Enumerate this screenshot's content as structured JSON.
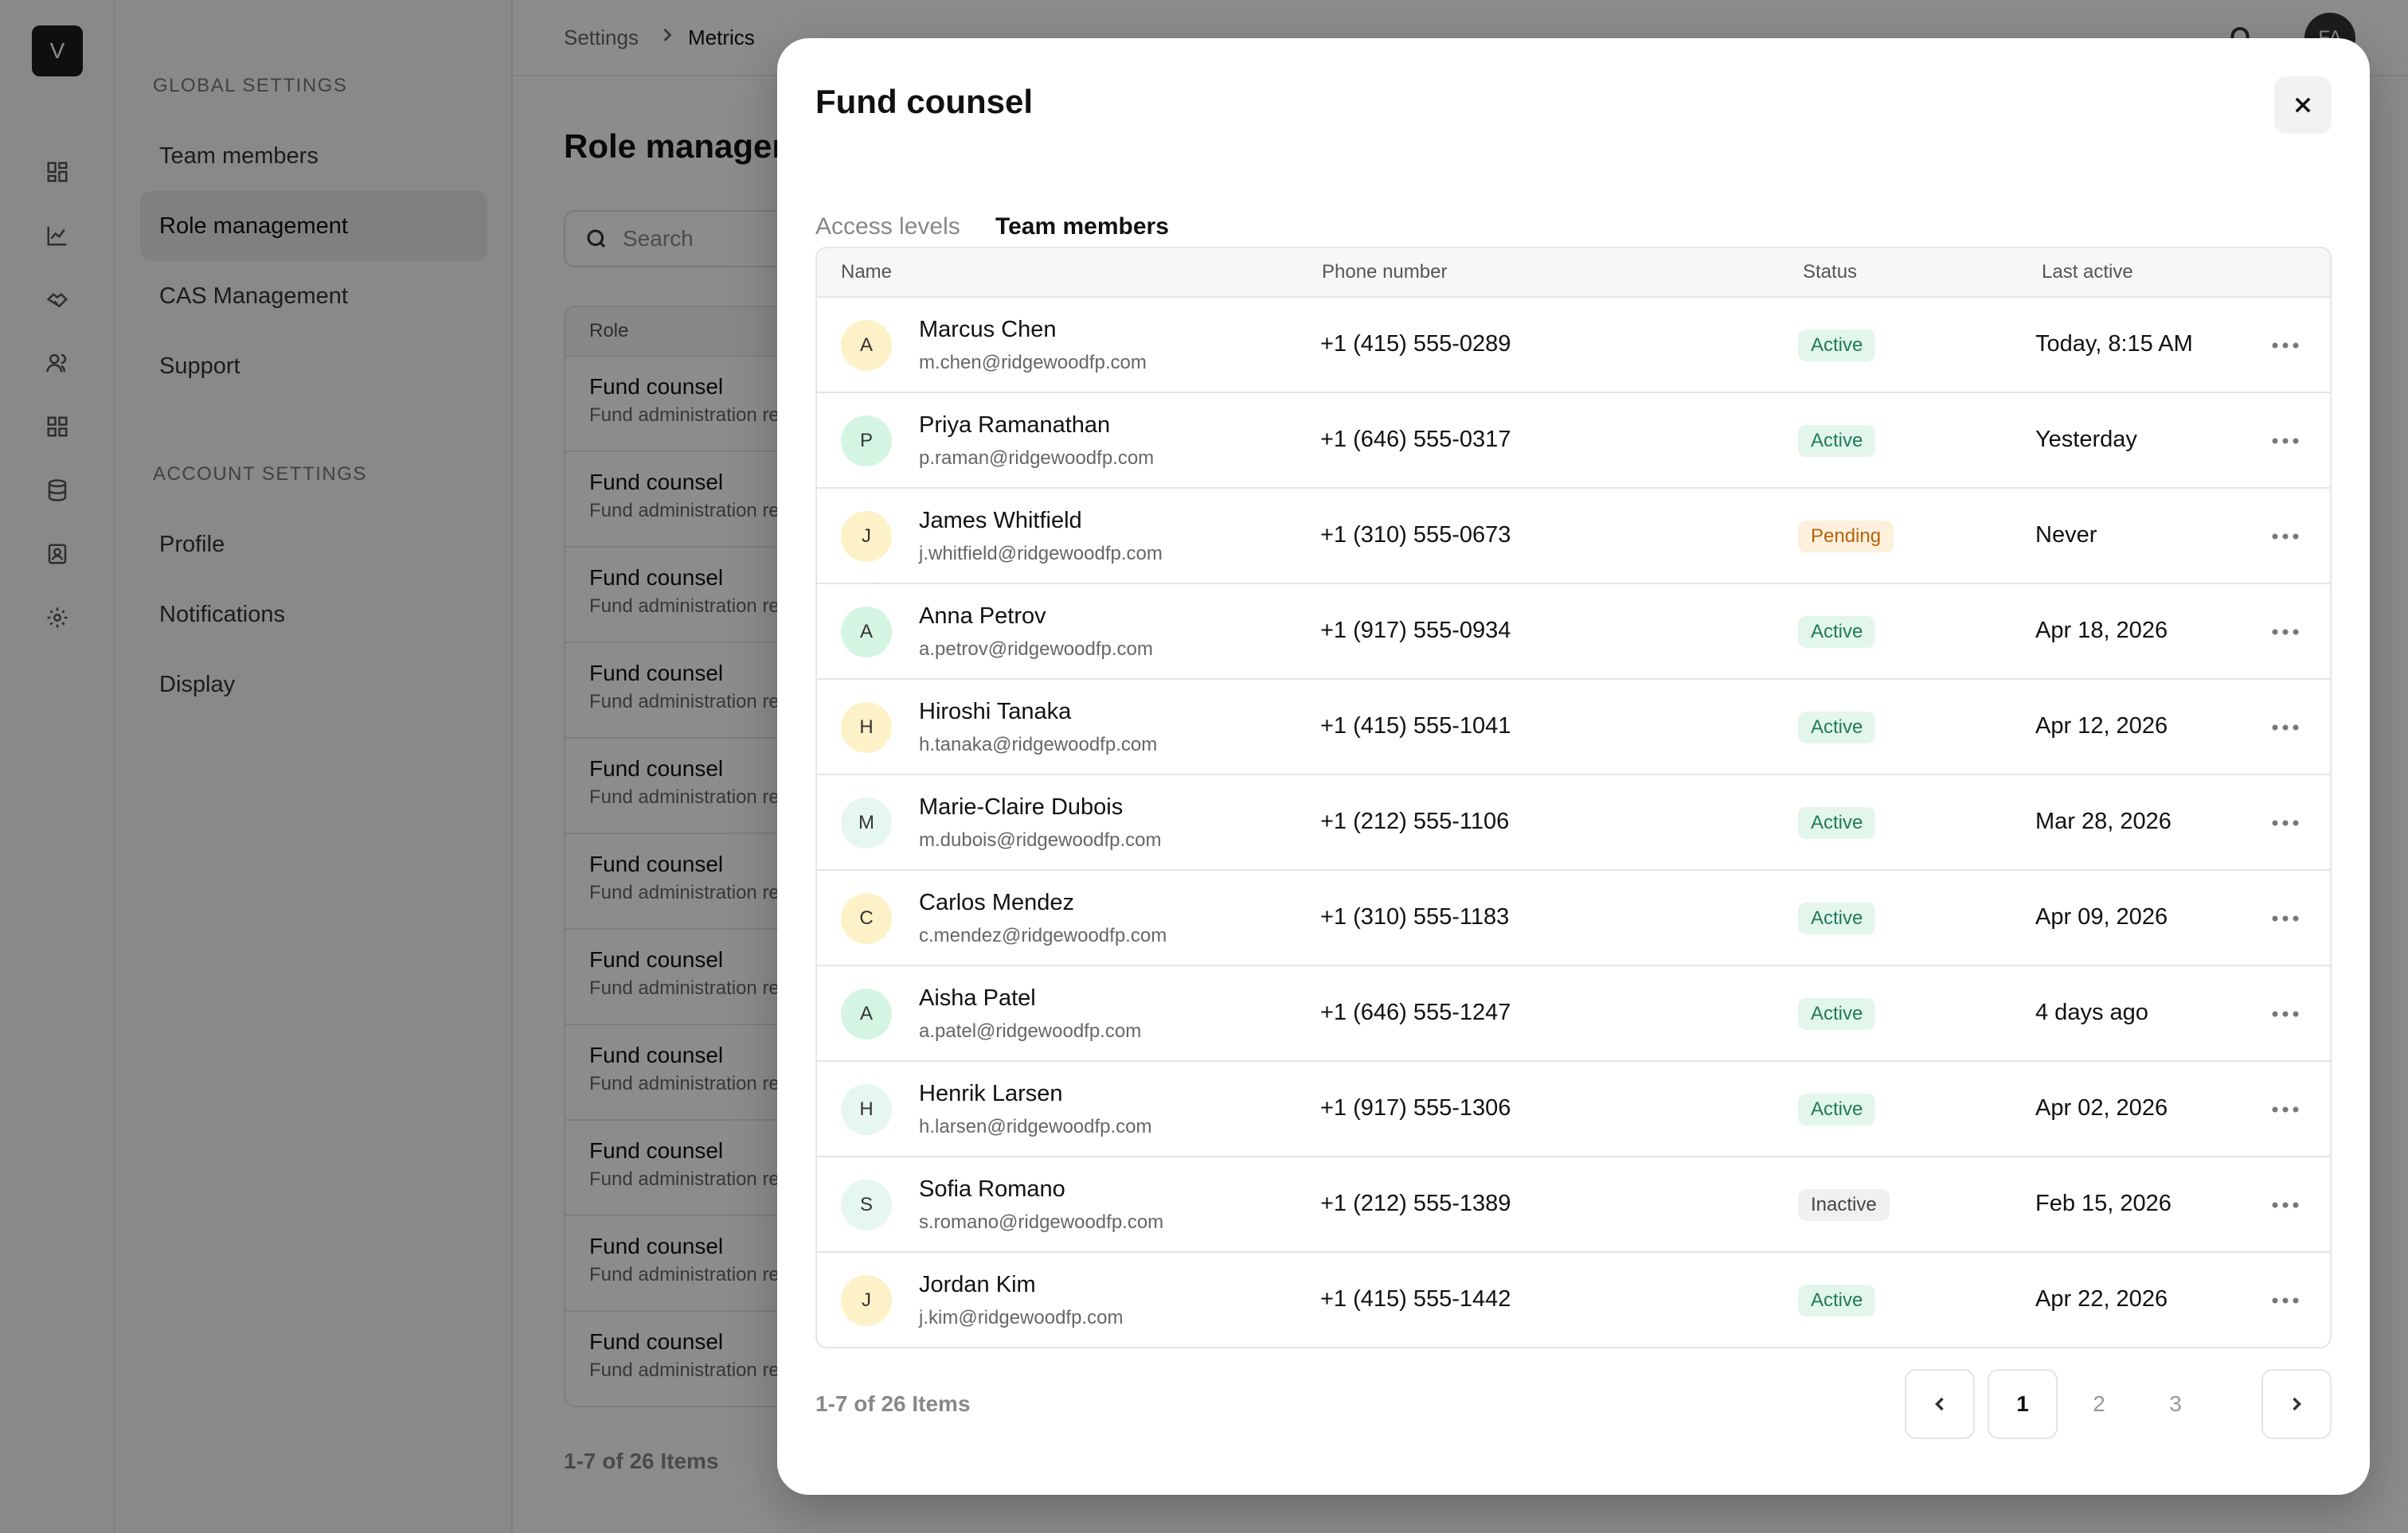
{
  "app": {
    "logo_letter": "V",
    "user_initials": "FA",
    "rail_icons": [
      "dashboard-icon",
      "chart-icon",
      "handshake-icon",
      "users-icon",
      "grid-icon",
      "database-icon",
      "contacts-icon",
      "gear-icon"
    ]
  },
  "settings_nav": {
    "global_heading": "GLOBAL SETTINGS",
    "global_items": [
      "Team members",
      "Role management",
      "CAS Management",
      "Support"
    ],
    "account_heading": "ACCOUNT SETTINGS",
    "account_items": [
      "Profile",
      "Notifications",
      "Display"
    ],
    "active_item": "Role management"
  },
  "background": {
    "breadcrumb": [
      "Settings",
      "Metrics"
    ],
    "page_title": "Role managen",
    "search_placeholder": "Search",
    "column_role": "Role",
    "role_rows": [
      {
        "title": "Fund counsel",
        "subtitle": "Fund administration re"
      },
      {
        "title": "Fund counsel",
        "subtitle": "Fund administration re"
      },
      {
        "title": "Fund counsel",
        "subtitle": "Fund administration re"
      },
      {
        "title": "Fund counsel",
        "subtitle": "Fund administration re"
      },
      {
        "title": "Fund counsel",
        "subtitle": "Fund administration re"
      },
      {
        "title": "Fund counsel",
        "subtitle": "Fund administration re"
      },
      {
        "title": "Fund counsel",
        "subtitle": "Fund administration re"
      },
      {
        "title": "Fund counsel",
        "subtitle": "Fund administration re"
      },
      {
        "title": "Fund counsel",
        "subtitle": "Fund administration re"
      },
      {
        "title": "Fund counsel",
        "subtitle": "Fund administration re"
      },
      {
        "title": "Fund counsel",
        "subtitle": "Fund administration re"
      }
    ],
    "footer_count": "1-7 of 26 Items"
  },
  "modal": {
    "title": "Fund counsel",
    "tabs": [
      "Access levels",
      "Team members"
    ],
    "active_tab": "Team members",
    "columns": [
      "Name",
      "Phone number",
      "Status",
      "Last active"
    ],
    "members": [
      {
        "initial": "A",
        "name": "Marcus Chen",
        "email": "m.chen@ridgewoodfp.com",
        "phone": "+1 (415) 555-0289",
        "status": "Active",
        "last_active": "Today, 8:15 AM",
        "avatar_color": "#fdf1c7"
      },
      {
        "initial": "P",
        "name": "Priya Ramanathan",
        "email": "p.raman@ridgewoodfp.com",
        "phone": "+1 (646) 555-0317",
        "status": "Active",
        "last_active": "Yesterday",
        "avatar_color": "#d5f5e3"
      },
      {
        "initial": "J",
        "name": "James Whitfield",
        "email": "j.whitfield@ridgewoodfp.com",
        "phone": "+1 (310) 555-0673",
        "status": "Pending",
        "last_active": "Never",
        "avatar_color": "#fdf1c7"
      },
      {
        "initial": "A",
        "name": "Anna Petrov",
        "email": "a.petrov@ridgewoodfp.com",
        "phone": "+1 (917) 555-0934",
        "status": "Active",
        "last_active": "Apr 18, 2026",
        "avatar_color": "#d5f5e3"
      },
      {
        "initial": "H",
        "name": "Hiroshi Tanaka",
        "email": "h.tanaka@ridgewoodfp.com",
        "phone": "+1 (415) 555-1041",
        "status": "Active",
        "last_active": "Apr 12, 2026",
        "avatar_color": "#fdf1c7"
      },
      {
        "initial": "M",
        "name": "Marie-Claire Dubois",
        "email": "m.dubois@ridgewoodfp.com",
        "phone": "+1 (212) 555-1106",
        "status": "Active",
        "last_active": "Mar 28, 2026",
        "avatar_color": "#e6f7ef"
      },
      {
        "initial": "C",
        "name": "Carlos Mendez",
        "email": "c.mendez@ridgewoodfp.com",
        "phone": "+1 (310) 555-1183",
        "status": "Active",
        "last_active": "Apr 09, 2026",
        "avatar_color": "#fdf1c7"
      },
      {
        "initial": "A",
        "name": "Aisha Patel",
        "email": "a.patel@ridgewoodfp.com",
        "phone": "+1 (646) 555-1247",
        "status": "Active",
        "last_active": "4 days ago",
        "avatar_color": "#d5f5e3"
      },
      {
        "initial": "H",
        "name": "Henrik Larsen",
        "email": "h.larsen@ridgewoodfp.com",
        "phone": "+1 (917) 555-1306",
        "status": "Active",
        "last_active": "Apr 02, 2026",
        "avatar_color": "#e6f7ef"
      },
      {
        "initial": "S",
        "name": "Sofia Romano",
        "email": "s.romano@ridgewoodfp.com",
        "phone": "+1 (212) 555-1389",
        "status": "Inactive",
        "last_active": "Feb 15, 2026",
        "avatar_color": "#e6f7ef"
      },
      {
        "initial": "J",
        "name": "Jordan Kim",
        "email": "j.kim@ridgewoodfp.com",
        "phone": "+1 (415) 555-1442",
        "status": "Active",
        "last_active": "Apr 22, 2026",
        "avatar_color": "#fdf1c7"
      }
    ],
    "footer_count": "1-7 of 26 Items",
    "pagination": {
      "pages": [
        "1",
        "2",
        "3"
      ],
      "current": "1"
    }
  },
  "colors": {
    "accent": "#1f7a5c",
    "status_active_bg": "#e3f6ec",
    "status_active_fg": "#1f7a5c",
    "status_pending_bg": "#fdf0dc",
    "status_pending_fg": "#b8620b",
    "status_inactive_bg": "#f0f0f0",
    "status_inactive_fg": "#444444"
  }
}
